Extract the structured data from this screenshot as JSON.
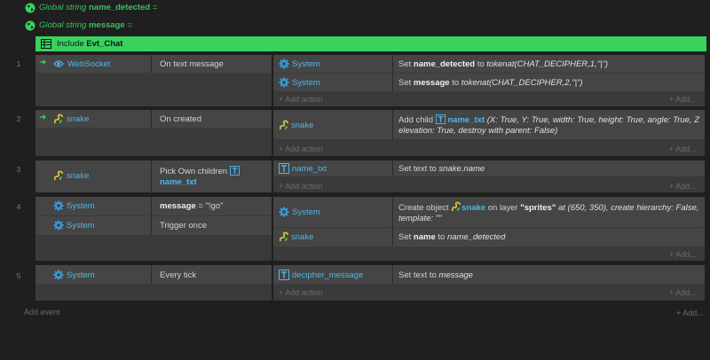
{
  "globals": [
    {
      "prefix": "Global string",
      "name": "name_detected",
      "suffix": "="
    },
    {
      "prefix": "Global string",
      "name": "message",
      "suffix": "="
    }
  ],
  "include": {
    "label": "Include",
    "sheet": "Evt_Chat"
  },
  "events": [
    {
      "number": "1",
      "conditions": [
        {
          "object": "WebSocket",
          "text": "On text message"
        }
      ],
      "actions": [
        {
          "object": "System",
          "pre": "Set",
          "bold": "name_detected",
          "mid": "to",
          "italic": "tokenat(CHAT_DECIPHER,1,\"|\")"
        },
        {
          "object": "System",
          "pre": "Set",
          "bold": "message",
          "mid": "to",
          "italic": "tokenat(CHAT_DECIPHER,2,\"|\")"
        }
      ],
      "add_action": "Add action",
      "add_more": "Add..."
    },
    {
      "number": "2",
      "conditions": [
        {
          "object": "snake",
          "text": "On created"
        }
      ],
      "actions": [
        {
          "object": "snake",
          "pre": "Add child",
          "child": "name_txt",
          "rest": "(X: True, Y: True, width: True, height: True, angle: True, Z elevation: True, destroy with parent: False)"
        }
      ],
      "add_action": "Add action",
      "add_more": "Add..."
    },
    {
      "number": "3",
      "conditions": [
        {
          "object": "snake",
          "text": "Pick Own children",
          "sub": "name_txt"
        }
      ],
      "actions": [
        {
          "object": "name_txt",
          "pre": "Set text to",
          "italic": "snake.name"
        }
      ],
      "add_action": "Add action",
      "add_more": "Add..."
    },
    {
      "number": "4",
      "conditions": [
        {
          "object": "System",
          "bold": "message",
          "text": "= \"!go\""
        },
        {
          "object": "System",
          "text": "Trigger once"
        }
      ],
      "actions": [
        {
          "object": "System",
          "pre": "Create object",
          "created": "snake",
          "mid": "on layer",
          "layer": "\"sprites\"",
          "rest": "at (650, 350), create hierarchy: False, template: \"\""
        },
        {
          "object": "snake",
          "pre": "Set",
          "bold": "name",
          "mid": "to",
          "italic": "name_detected"
        }
      ],
      "add_action": "Add action",
      "add_more": "Add..."
    },
    {
      "number": "5",
      "conditions": [
        {
          "object": "System",
          "text": "Every tick"
        }
      ],
      "actions": [
        {
          "object": "decipher_message",
          "pre": "Set text to",
          "italic": "message"
        }
      ],
      "add_action": "Add action",
      "add_more": "Add..."
    }
  ],
  "footer": {
    "add_event": "Add event",
    "add_more": "Add..."
  },
  "colors": {
    "accent_green": "#3ad15f",
    "object_blue": "#4fb7ea",
    "row_bg": "#3a3a3a",
    "line_bg": "#454545"
  }
}
